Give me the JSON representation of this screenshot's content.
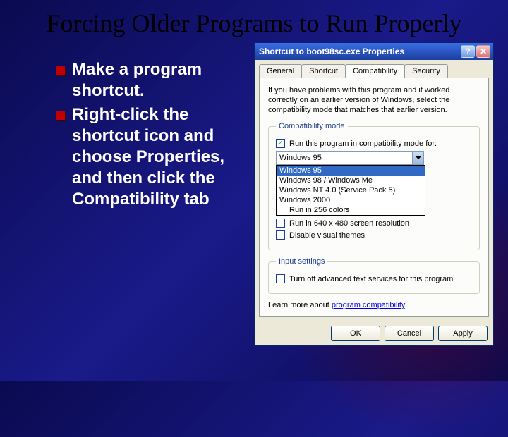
{
  "slide": {
    "title": "Forcing Older Programs to Run Properly",
    "bullets": [
      "Make a program shortcut.",
      "Right-click the shortcut icon and choose Properties, and then click the Compatibility tab"
    ]
  },
  "dialog": {
    "title": "Shortcut to boot98sc.exe Properties",
    "help_btn": "?",
    "close_btn": "✕",
    "tabs": {
      "general": "General",
      "shortcut": "Shortcut",
      "compatibility": "Compatibility",
      "security": "Security"
    },
    "description": "If you have problems with this program and it worked correctly on an earlier version of Windows, select the compatibility mode that matches that earlier version.",
    "compat_mode": {
      "legend": "Compatibility mode",
      "checkbox": "Run this program in compatibility mode for:",
      "selected": "Windows 95",
      "options": [
        "Windows 95",
        "Windows 98 / Windows Me",
        "Windows NT 4.0 (Service Pack 5)",
        "Windows 2000"
      ],
      "extra_option": "Run in 256 colors"
    },
    "display": {
      "item1": "Run in 640 x 480 screen resolution",
      "item2": "Disable visual themes"
    },
    "input_settings": {
      "legend": "Input settings",
      "item": "Turn off advanced text services for this program"
    },
    "learn_text": "Learn more about ",
    "learn_link": "program compatibility",
    "buttons": {
      "ok": "OK",
      "cancel": "Cancel",
      "apply": "Apply"
    }
  }
}
